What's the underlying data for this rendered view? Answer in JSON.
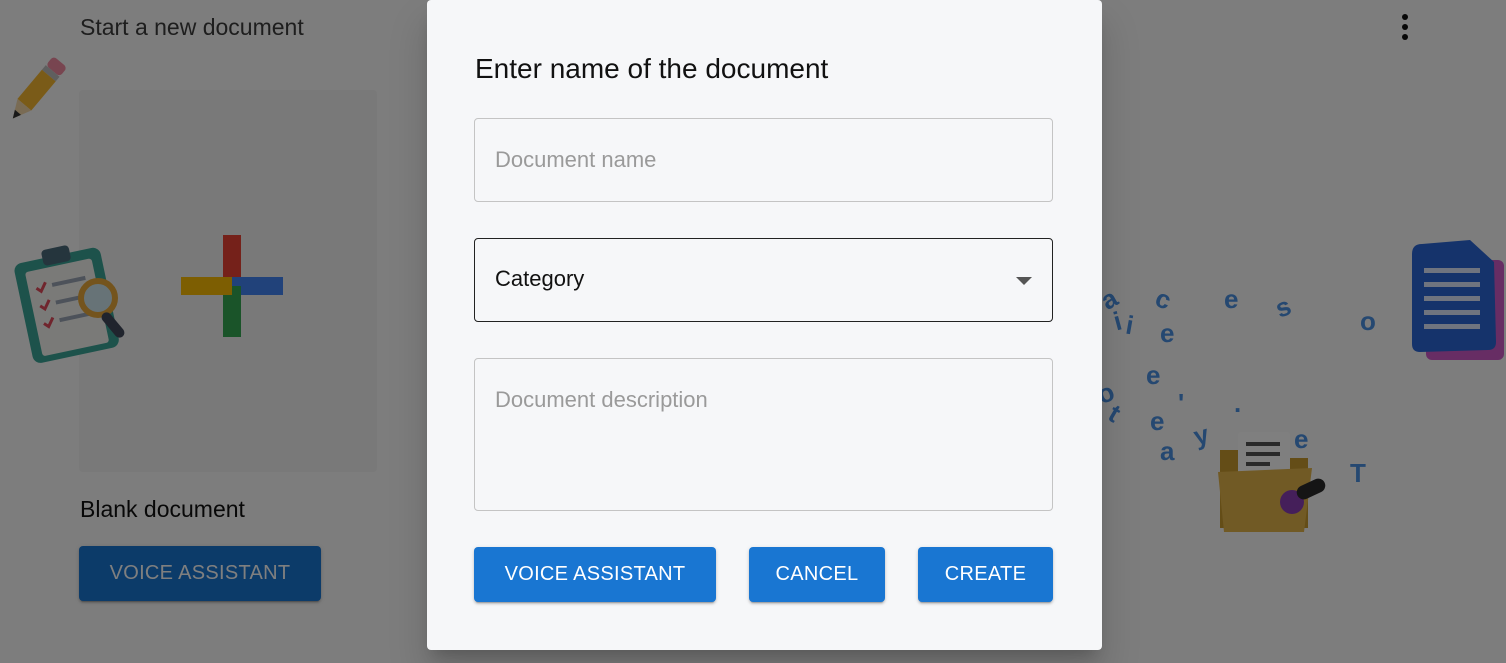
{
  "background": {
    "section_title": "Start a new document",
    "blank_document_label": "Blank document",
    "voice_assistant_label": "VOICE ASSISTANT",
    "floating_letters": [
      "a",
      "c",
      "e",
      "s",
      "o",
      "i",
      "i",
      "e",
      "e",
      "'",
      "e",
      "y",
      "a",
      "e",
      "T",
      "t",
      "o",
      "."
    ]
  },
  "dialog": {
    "title": "Enter name of the document",
    "name_placeholder": "Document name",
    "category_label": "Category",
    "description_placeholder": "Document description",
    "voice_assistant_label": "VOICE ASSISTANT",
    "cancel_label": "CANCEL",
    "create_label": "CREATE"
  },
  "colors": {
    "primary": "#1976d2",
    "overlay": "rgba(0,0,0,0.5)",
    "dialog_bg": "#f6f7f9",
    "google_red": "#ea4335",
    "google_blue": "#4285f4",
    "google_yellow": "#fbbc05",
    "google_green": "#34a853"
  },
  "icons": {
    "menu": "more-vert-icon",
    "blank": "google-plus-icon",
    "category_caret": "caret-down-icon",
    "decor": [
      "pencil-icon",
      "clipboard-search-icon",
      "document-stack-icon",
      "folder-microphone-icon"
    ]
  }
}
